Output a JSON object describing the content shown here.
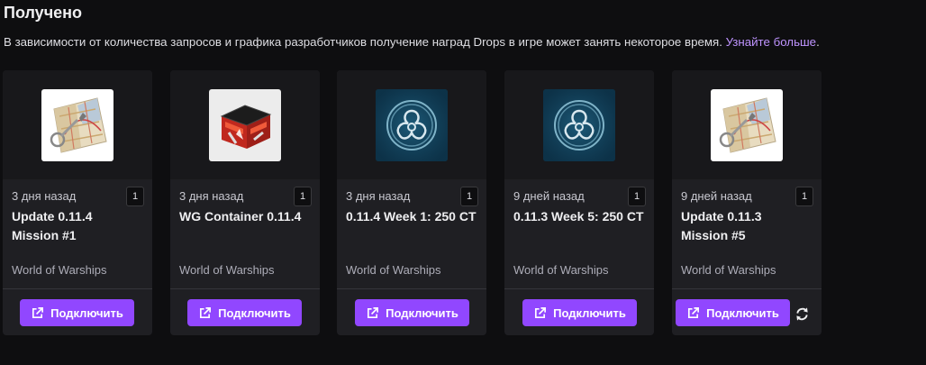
{
  "header": {
    "title": "Получено",
    "description": "В зависимости от количества запросов и графика разработчиков получение наград Drops в игре может занять некоторое время.",
    "learn_more": "Узнайте больше"
  },
  "cards": [
    {
      "time": "3 дня назад",
      "count": "1",
      "name": "Update 0.11.4 Mission #1",
      "game": "World of Warships",
      "button": "Подключить",
      "image": "map-icon"
    },
    {
      "time": "3 дня назад",
      "count": "1",
      "name": "WG Container 0.11.4",
      "game": "World of Warships",
      "button": "Подключить",
      "image": "container-icon"
    },
    {
      "time": "3 дня назад",
      "count": "1",
      "name": "0.11.4 Week 1: 250 CT",
      "game": "World of Warships",
      "button": "Подключить",
      "image": "commander-xp-icon"
    },
    {
      "time": "9 дней назад",
      "count": "1",
      "name": "0.11.3 Week 5: 250 CT",
      "game": "World of Warships",
      "button": "Подключить",
      "image": "commander-xp-icon"
    },
    {
      "time": "9 дней назад",
      "count": "1",
      "name": "Update 0.11.3 Mission #5",
      "game": "World of Warships",
      "button": "Подключить",
      "image": "map-icon"
    }
  ],
  "colors": {
    "accent": "#9147ff",
    "link": "#bf94ff",
    "card": "#1f1f23",
    "background": "#0e0e10"
  }
}
